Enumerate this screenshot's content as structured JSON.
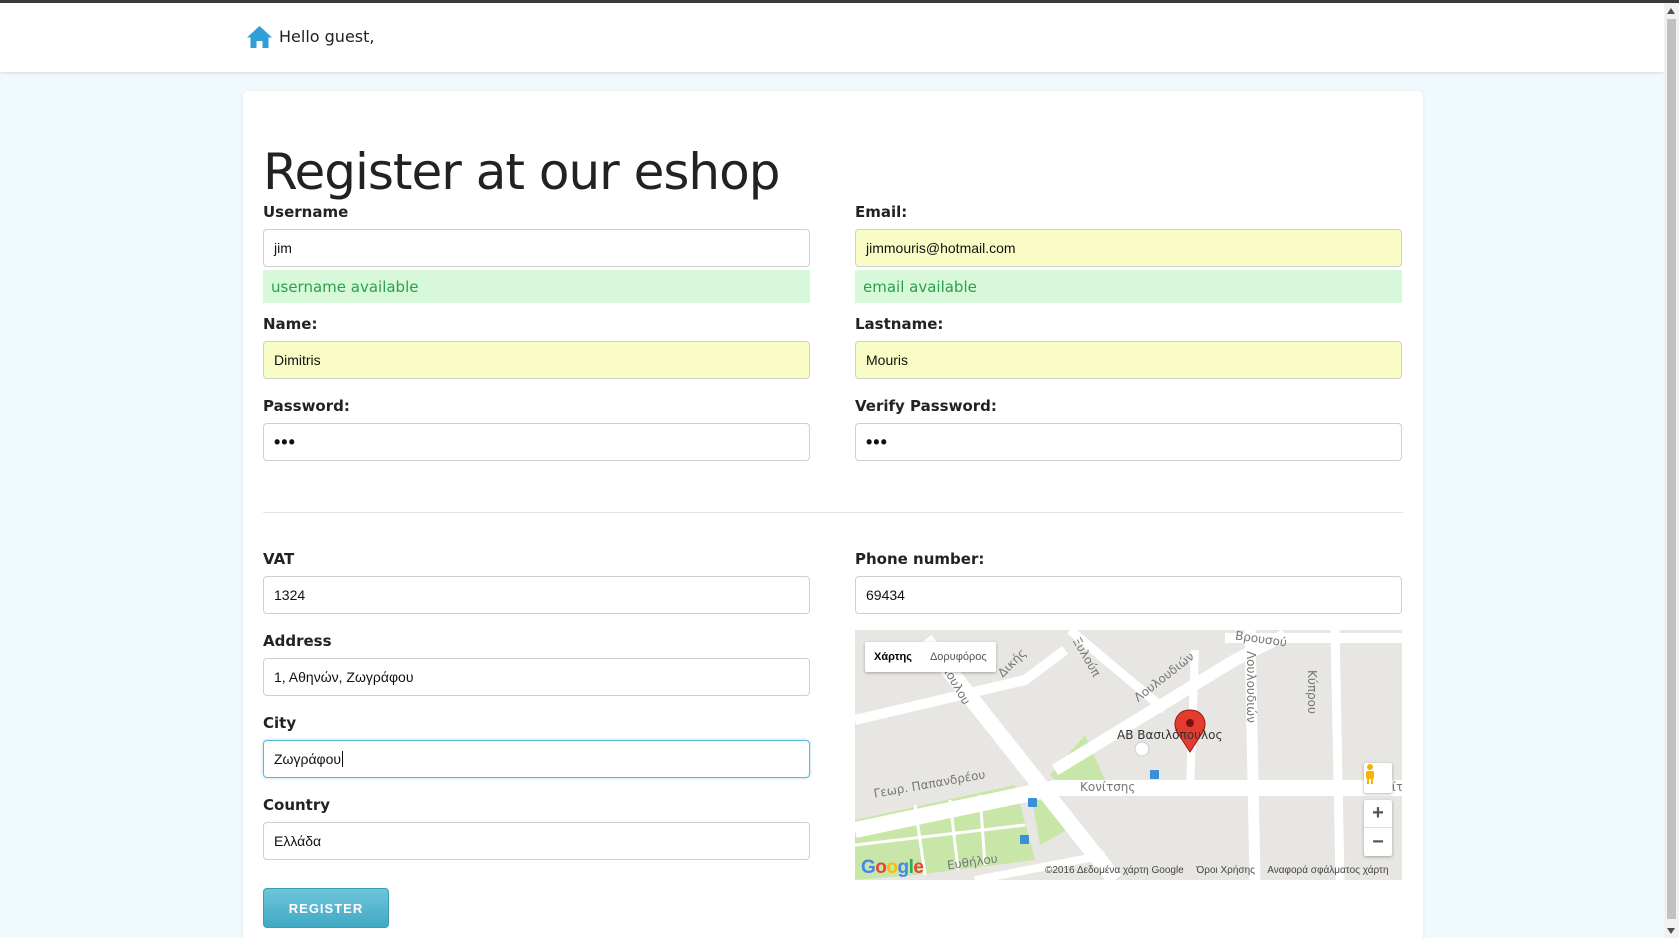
{
  "header": {
    "greeting": "Hello guest,"
  },
  "page": {
    "title": "Register at our eshop"
  },
  "form": {
    "username": {
      "label": "Username",
      "value": "jim",
      "status": "username available"
    },
    "email": {
      "label": "Email:",
      "value": "jimmouris@hotmail.com",
      "status": "email available"
    },
    "name": {
      "label": "Name:",
      "value": "Dimitris"
    },
    "lastname": {
      "label": "Lastname:",
      "value": "Mouris"
    },
    "password": {
      "label": "Password:",
      "value": "•••"
    },
    "verify_password": {
      "label": "Verify Password:",
      "value": "•••"
    },
    "vat": {
      "label": "VAT",
      "value": "1324"
    },
    "phone": {
      "label": "Phone number:",
      "value": "69434"
    },
    "address": {
      "label": "Address",
      "value": "1, Αθηνών, Ζωγράφου"
    },
    "city": {
      "label": "City",
      "value": "Ζωγράφου"
    },
    "country": {
      "label": "Country",
      "value": "Ελλάδα"
    },
    "submit_label": "REGISTER"
  },
  "map": {
    "type_map": "Χάρτης",
    "type_satellite": "Δορυφόρος",
    "zoom_in": "+",
    "zoom_out": "−",
    "poi_name": "ΑΒ Βασιλόπουλος",
    "streets": {
      "papandreou": "Γεωρ. Παπανδρέου",
      "konitsis": "Κονίτσης",
      "konitsis_short": "Κονίτ",
      "louloudion_a": "Λουλουδιών",
      "louloudion_b": "Λουλουδιών",
      "kyprou": "Κύπρου",
      "dikis": "Δικής",
      "xylou": "Ξυλούπ",
      "euthilou": "Ευθήλου",
      "poulou": "πουλου",
      "vrousou": "Βρουσού"
    },
    "google_logo": "Google",
    "footer": {
      "copyright": "©2016 Δεδομένα χάρτη Google",
      "terms": "Όροι Χρήσης",
      "report": "Αναφορά σφάλματος χάρτη"
    }
  },
  "colors": {
    "accent": "#40a9c4",
    "status_bg": "#d7f8d9",
    "status_text": "#2ba04a",
    "autofill_bg": "#fafcc6",
    "home_icon": "#2f9fd6"
  }
}
